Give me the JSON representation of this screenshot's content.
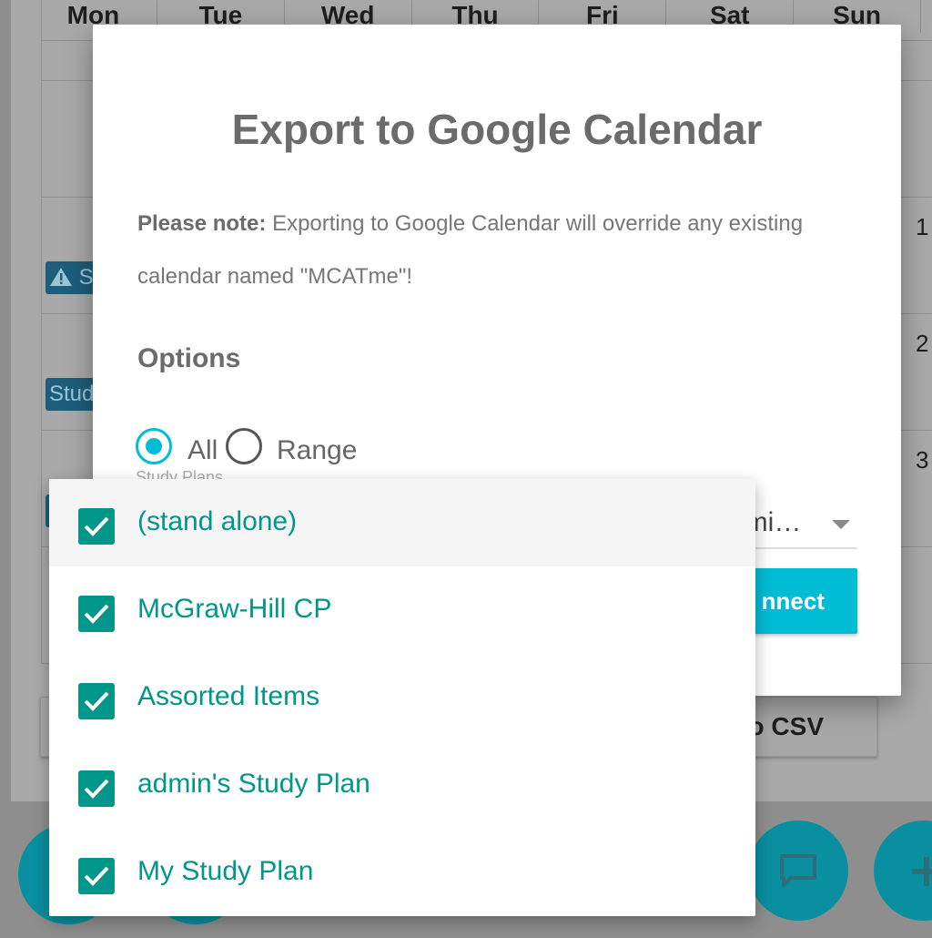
{
  "calendar": {
    "days": [
      "Mon",
      "Tue",
      "Wed",
      "Thu",
      "Fri",
      "Sat",
      "Sun"
    ],
    "week_numbers": [
      "1",
      "2",
      "3"
    ],
    "chips": [
      "S",
      "Stud"
    ],
    "export_csv_label": "t to CSV"
  },
  "modal": {
    "title": "Export to Google Calendar",
    "note_bold": "Please note:",
    "note_text": "Exporting to Google Calendar will override any existing calendar named \"MCATme\"!",
    "options_title": "Options",
    "radio_all": "All",
    "radio_range": "Range",
    "radio_selected": "All",
    "study_plans_label": "Study Plans",
    "study_plans_value": "dmi…",
    "connect_label": "nnect"
  },
  "dropdown": {
    "items": [
      {
        "label": "(stand alone)",
        "checked": true
      },
      {
        "label": "McGraw-Hill CP",
        "checked": true
      },
      {
        "label": "Assorted Items",
        "checked": true
      },
      {
        "label": "admin's Study Plan",
        "checked": true
      },
      {
        "label": "My Study Plan",
        "checked": true
      }
    ]
  },
  "icons": [
    "warning-icon",
    "chat-icon",
    "add-icon",
    "checkmark-icon"
  ],
  "colors": {
    "accent": "#00bcd4",
    "checkbox": "#009688",
    "fab": "#0a8fa1",
    "chip": "#1d5e7c"
  }
}
